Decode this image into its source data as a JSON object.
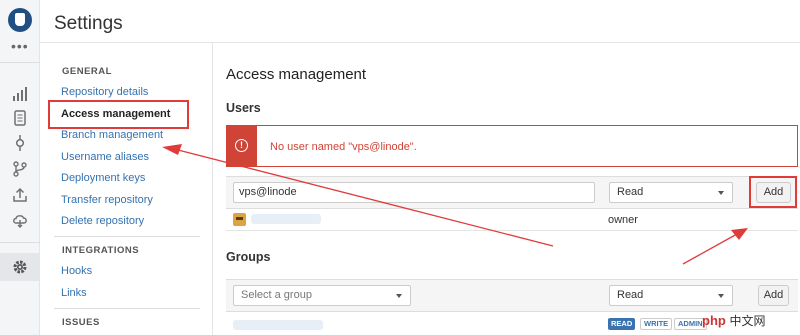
{
  "page": {
    "title": "Settings"
  },
  "rail": {
    "more": "•••",
    "icons": [
      "logo-icon",
      "more-icon",
      "stats-icon",
      "source-icon",
      "commits-icon",
      "branches-icon",
      "upload-icon",
      "cloud-icon",
      "settings-gear-icon"
    ]
  },
  "sidebar": {
    "sections": [
      {
        "heading": "GENERAL",
        "items": [
          "Repository details",
          "Access management",
          "Branch management",
          "Username aliases",
          "Deployment keys",
          "Transfer repository",
          "Delete repository"
        ]
      },
      {
        "heading": "INTEGRATIONS",
        "items": [
          "Hooks",
          "Links"
        ]
      },
      {
        "heading": "ISSUES",
        "items": []
      }
    ],
    "active": "Access management"
  },
  "main": {
    "title": "Access management",
    "users": {
      "heading": "Users",
      "error": "No user named \"vps@linode\".",
      "input_value": "vps@linode",
      "permission": "Read",
      "add_label": "Add",
      "rows": [
        {
          "role": "owner"
        }
      ]
    },
    "groups": {
      "heading": "Groups",
      "placeholder": "Select a group",
      "permission": "Read",
      "add_label": "Add",
      "permission_badges": [
        "READ",
        "WRITE",
        "ADMIN"
      ]
    }
  },
  "annotation": {
    "color": "#e03b3b"
  },
  "watermark": {
    "logo": "php",
    "text": "中文网"
  }
}
